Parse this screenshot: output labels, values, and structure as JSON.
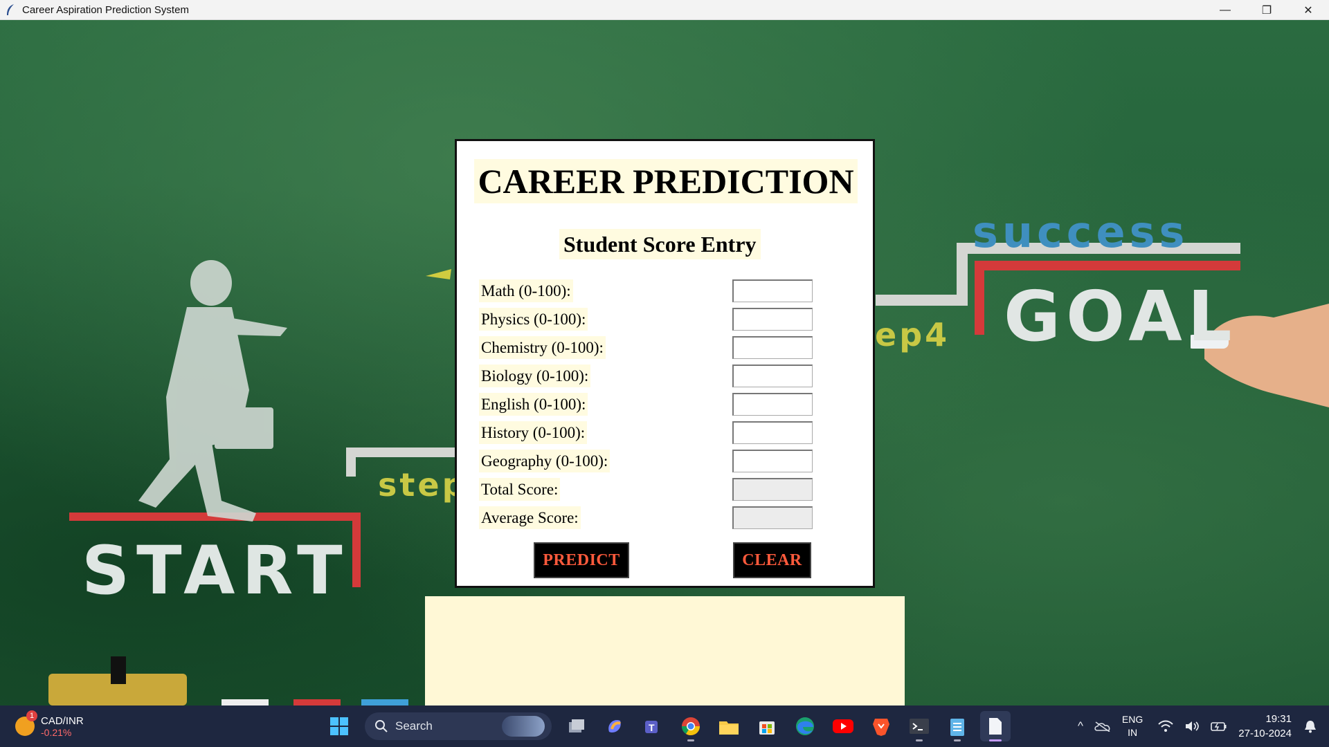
{
  "window": {
    "title": "Career Aspiration Prediction System",
    "controls": {
      "minimize": "—",
      "maximize": "❐",
      "close": "✕"
    }
  },
  "background": {
    "start": "START",
    "goal": "GOAL",
    "success": "success",
    "step": "step",
    "step4": "ep4"
  },
  "form": {
    "title": "CAREER PREDICTION",
    "subtitle": "Student Score Entry",
    "fields": [
      {
        "label": "Math (0-100):",
        "value": ""
      },
      {
        "label": "Physics (0-100):",
        "value": ""
      },
      {
        "label": "Chemistry (0-100):",
        "value": ""
      },
      {
        "label": "Biology (0-100):",
        "value": ""
      },
      {
        "label": "English (0-100):",
        "value": ""
      },
      {
        "label": "History (0-100):",
        "value": ""
      },
      {
        "label": "Geography (0-100):",
        "value": ""
      }
    ],
    "total": {
      "label": "Total Score:",
      "value": ""
    },
    "average": {
      "label": "Average Score:",
      "value": ""
    },
    "predict_label": "PREDICT",
    "clear_label": "CLEAR",
    "button_text_color": "#ff5a3c"
  },
  "taskbar": {
    "widget": {
      "name": "CAD/INR",
      "change": "-0.21%",
      "badge": "1"
    },
    "search_label": "Search",
    "icons": [
      "start-icon",
      "task-view-icon",
      "copilot-icon",
      "teams-icon",
      "chrome-icon",
      "file-explorer-icon",
      "store-icon",
      "edge-icon",
      "youtube-icon",
      "brave-icon",
      "terminal-icon",
      "notepad-icon",
      "file-icon"
    ],
    "tray": {
      "chevron": "^",
      "lang_top": "ENG",
      "lang_bottom": "IN",
      "time": "19:31",
      "date": "27-10-2024"
    }
  }
}
